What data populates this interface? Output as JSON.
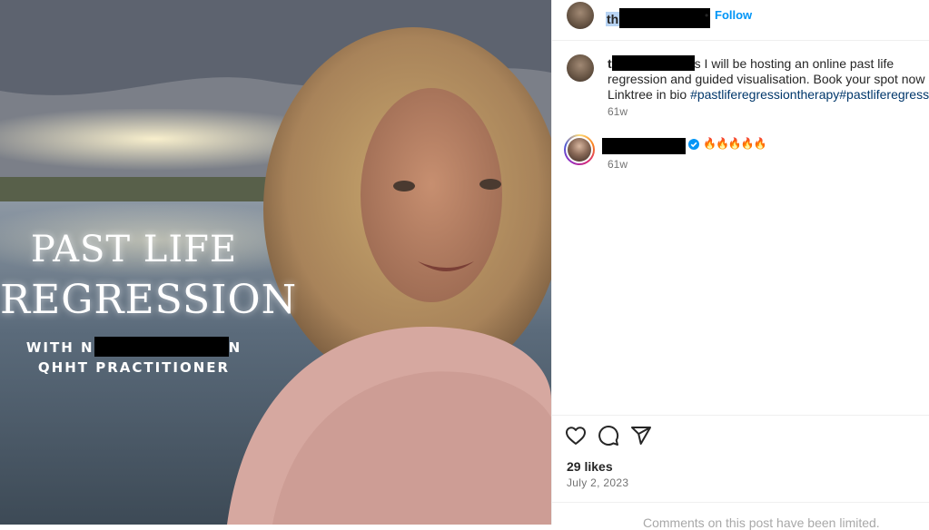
{
  "post_image": {
    "title_line1": "PAST LIFE",
    "title_line2": "REGRESSION",
    "subtitle_prefix": "WITH N",
    "subtitle_suffix": "N",
    "subtitle_line2": "QHHT PRACTITIONER"
  },
  "header": {
    "username_visible": "th",
    "separator": "•",
    "follow_label": "Follow"
  },
  "caption": {
    "username_visible": "t",
    "text_after_redaction": "s I will be hosting an online past life",
    "line2": "regression and guided visualisation. Book your spot now on",
    "line3_plain": "Linktree in bio ",
    "hashtags": "#pastliferegressiontherapy#pastliferegressio",
    "time": "61w"
  },
  "comment": {
    "text": "🔥🔥🔥🔥🔥",
    "time": "61w"
  },
  "actions": {
    "like_icon": "heart-outline-icon",
    "comment_icon": "speech-bubble-icon",
    "share_icon": "paper-plane-icon"
  },
  "stats": {
    "likes": "29 likes",
    "date": "July 2, 2023"
  },
  "footer": {
    "limited_text": "Comments on this post have been limited."
  },
  "colors": {
    "follow_blue": "#0095f6",
    "hashtag_blue": "#00376b",
    "muted_gray": "#737373"
  }
}
